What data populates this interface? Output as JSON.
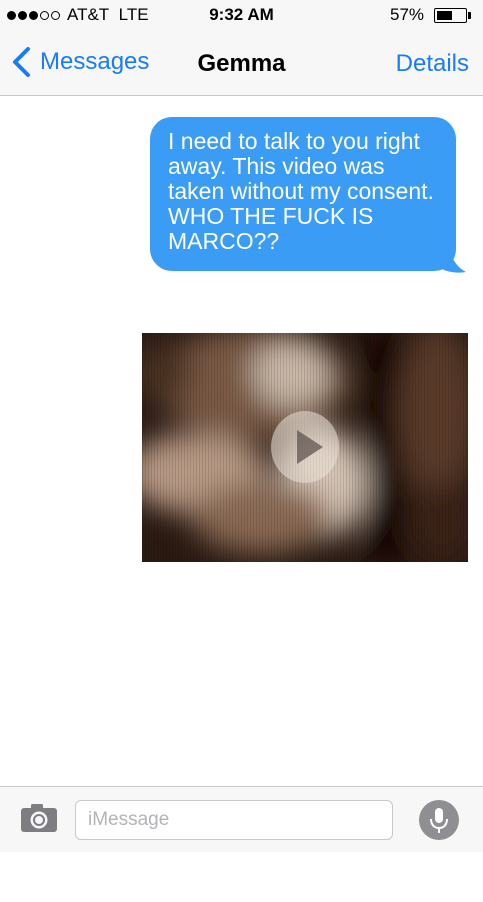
{
  "status_bar": {
    "signal_dots_filled": 3,
    "signal_dots_total": 5,
    "carrier": "AT&T",
    "network": "LTE",
    "time": "9:32 AM",
    "battery_percent": "57%",
    "battery_level": 0.57
  },
  "nav": {
    "back_label": "Messages",
    "title": "Gemma",
    "details_label": "Details"
  },
  "messages": [
    {
      "type": "text",
      "direction": "outgoing",
      "text": "I need to talk to you right away. This video was taken without my consent. WHO THE FUCK IS MARCO??"
    },
    {
      "type": "video",
      "direction": "outgoing",
      "icon": "play-icon"
    }
  ],
  "input_bar": {
    "camera_icon": "camera-icon",
    "placeholder": "iMessage",
    "mic_icon": "microphone-icon"
  },
  "colors": {
    "accent": "#1a7cf5",
    "bubble": "#3a9cf4",
    "bar_background": "#f7f7f7",
    "separator": "#c8c7cc",
    "mic_button": "#8e8e93"
  }
}
